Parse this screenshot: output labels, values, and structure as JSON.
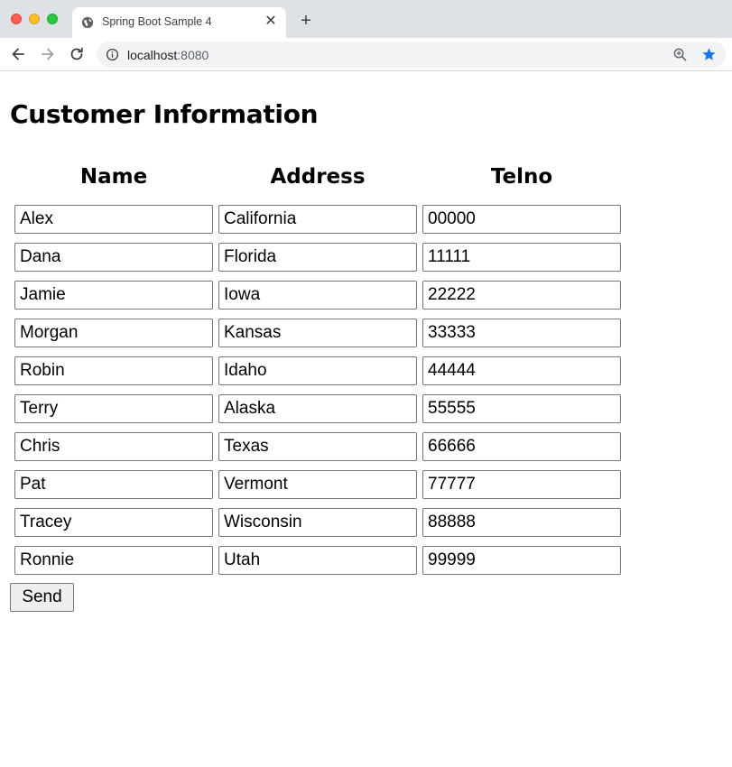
{
  "browser": {
    "tab": {
      "title": "Spring Boot Sample 4",
      "close_glyph": "✕",
      "icon": "globe-icon"
    },
    "new_tab_glyph": "+",
    "address_bar": {
      "host": "localhost",
      "port": ":8080"
    },
    "icons": [
      "back-arrow-icon",
      "forward-arrow-icon",
      "reload-icon",
      "info-icon",
      "zoom-icon",
      "bookmark-star-icon"
    ],
    "colors": {
      "star": "#1a73e8",
      "tabbar": "#dee1e6"
    }
  },
  "page": {
    "title": "Customer Information",
    "columns": [
      "Name",
      "Address",
      "Telno"
    ],
    "customers": [
      {
        "name": "Alex",
        "address": "California",
        "telno": "00000"
      },
      {
        "name": "Dana",
        "address": "Florida",
        "telno": "11111"
      },
      {
        "name": "Jamie",
        "address": "Iowa",
        "telno": "22222"
      },
      {
        "name": "Morgan",
        "address": "Kansas",
        "telno": "33333"
      },
      {
        "name": "Robin",
        "address": "Idaho",
        "telno": "44444"
      },
      {
        "name": "Terry",
        "address": "Alaska",
        "telno": "55555"
      },
      {
        "name": "Chris",
        "address": "Texas",
        "telno": "66666"
      },
      {
        "name": "Pat",
        "address": "Vermont",
        "telno": "77777"
      },
      {
        "name": "Tracey",
        "address": "Wisconsin",
        "telno": "88888"
      },
      {
        "name": "Ronnie",
        "address": "Utah",
        "telno": "99999"
      }
    ],
    "send_label": "Send"
  }
}
